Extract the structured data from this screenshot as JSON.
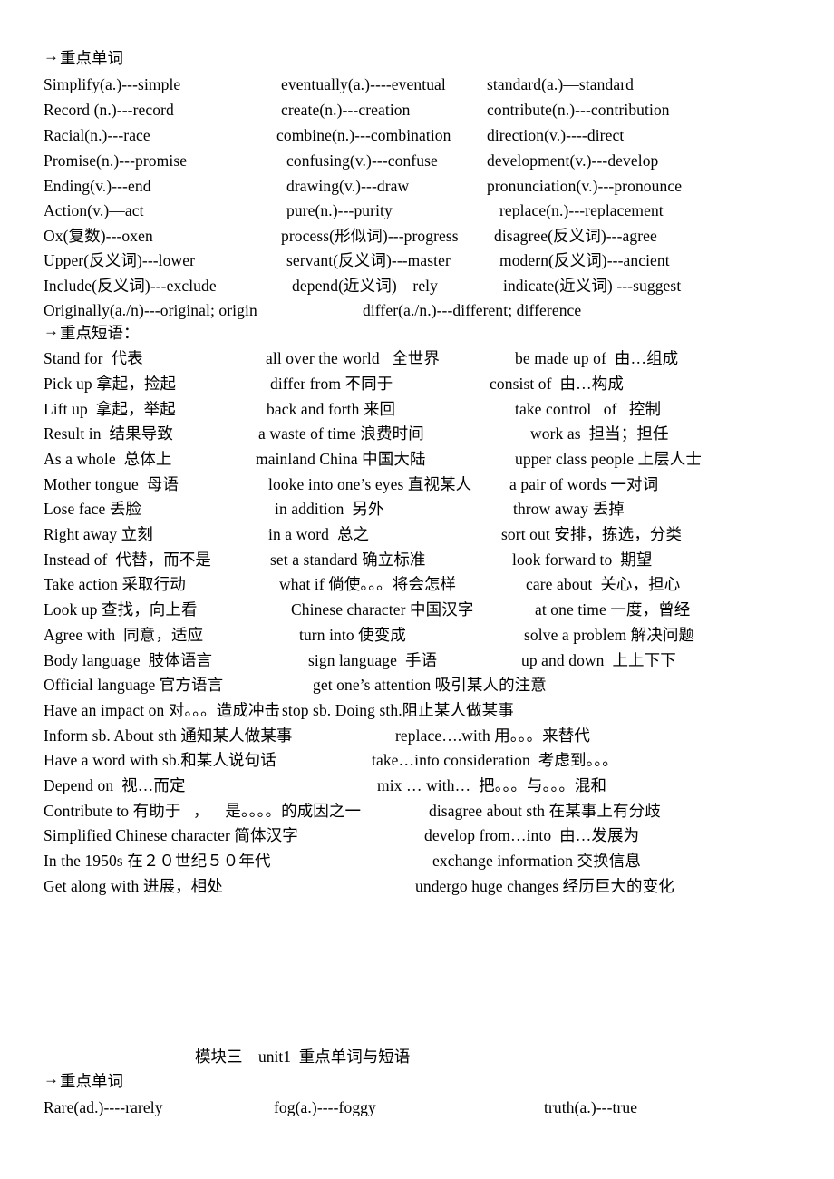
{
  "document": {
    "background_color": "#ffffff",
    "text_color": "#000000",
    "mid_title": "模块三    unit1  重点单词与短语"
  },
  "section_words_1": {
    "heading": "重点单词",
    "arrow_glyph": "→",
    "col1": [
      "Simplify(a.)---simple",
      "Record (n.)---record",
      "Racial(n.)---race",
      "Promise(n.)---promise",
      "Ending(v.)---end",
      "Action(v.)—act",
      "Ox(复数)---oxen",
      "Upper(反义词)---lower",
      "Include(反义词)---exclude",
      "Originally(a./n)---original; origin"
    ],
    "col2": [
      "eventually(a.)----eventual",
      "create(n.)---creation",
      "combine(n.)---combination",
      "confusing(v.)---confuse",
      "drawing(v.)---draw",
      "pure(n.)---purity",
      "process(形似词)---progress",
      "servant(反义词)---master",
      "depend(近义词)—rely",
      "differ(a./n.)---different; difference"
    ],
    "col3": [
      "standard(a.)—standard",
      "contribute(n.)---contribution",
      "direction(v.)----direct",
      "development(v.)---develop",
      "pronunciation(v.)---pronounce",
      "replace(n.)---replacement",
      "disagree(反义词)---agree",
      "modern(反义词)---ancient",
      "indicate(近义词) ---suggest"
    ]
  },
  "section_phrases": {
    "heading": "重点短语：",
    "arrow_glyph": "→",
    "col1": [
      "Stand for  代表",
      "Pick up 拿起，捡起",
      "Lift up  拿起，举起",
      "Result in  结果导致",
      "As a whole  总体上",
      "Mother tongue  母语",
      "Lose face 丢脸",
      "Right away 立刻",
      "Instead of  代替，而不是",
      "Take action 采取行动",
      "Look up 查找，向上看",
      "Agree with  同意，适应",
      "Body language  肢体语言",
      "Official language 官方语言",
      "Have an impact on 对。。。造成冲击",
      "Inform sb. About sth 通知某人做某事",
      "Have a word with sb.和某人说句话",
      "Depend on  视…而定",
      "Contribute to 有助于   ，    是。。。。的成因之一",
      "Simplified Chinese character 简体汉字",
      "In the 1950s 在２０世纪５０年代",
      "Get along with 进展，相处"
    ],
    "col2": [
      "all over the world   全世界",
      "differ from 不同于",
      "back and forth 来回",
      "a waste of time 浪费时间",
      "mainland China 中国大陆",
      "looke into one’s eyes 直视某人",
      "in addition  另外",
      "in a word  总之",
      "set a standard 确立标准",
      "what if 倘使。。。将会怎样",
      "Chinese character 中国汉字",
      "turn into 使变成",
      "sign language  手语",
      "get one’s attention 吸引某人的注意",
      "stop sb. Doing sth.阻止某人做某事",
      "replace….with 用。。。来替代",
      "take…into consideration  考虑到。。。",
      "mix … with…  把。。。与。。。混和",
      "disagree about sth 在某事上有分歧",
      "develop from…into  由…发展为",
      "exchange information 交换信息",
      "undergo huge changes 经历巨大的变化"
    ],
    "col3": [
      "be made up of  由…组成",
      "consist of  由…构成",
      "take control   of   控制",
      "work as  担当；担任",
      "upper class people 上层人士",
      "a pair of words 一对词",
      "throw away 丢掉",
      "sort out 安排，拣选，分类",
      "look forward to  期望",
      "care about  关心，担心",
      "at one time 一度，曾经",
      "solve a problem 解决问题",
      "up and down  上上下下"
    ]
  },
  "section_words_2": {
    "heading": "重点单词",
    "arrow_glyph": "→",
    "col1": [
      "Rare(ad.)----rarely"
    ],
    "col2": [
      "fog(a.)----foggy"
    ],
    "col3": [
      "truth(a.)---true"
    ]
  }
}
